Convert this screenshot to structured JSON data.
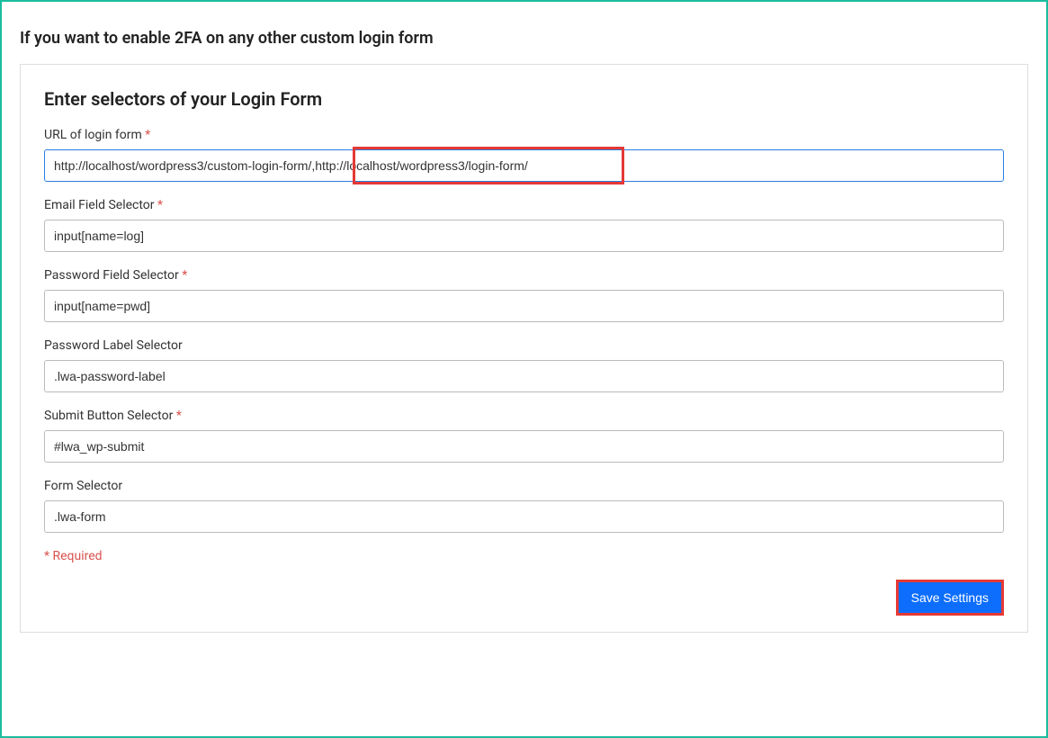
{
  "section_title": "If you want to enable 2FA on any other custom login form",
  "form_heading": "Enter selectors of your Login Form",
  "fields": {
    "url": {
      "label": "URL of login form",
      "required": true,
      "value": "http://localhost/wordpress3/custom-login-form/,http://localhost/wordpress3/login-form/"
    },
    "email_selector": {
      "label": "Email Field Selector",
      "required": true,
      "value": "input[name=log]"
    },
    "password_selector": {
      "label": "Password Field Selector",
      "required": true,
      "value": "input[name=pwd]"
    },
    "password_label_selector": {
      "label": "Password Label Selector",
      "required": false,
      "value": ".lwa-password-label"
    },
    "submit_selector": {
      "label": "Submit Button Selector",
      "required": true,
      "value": "#lwa_wp-submit"
    },
    "form_selector": {
      "label": "Form Selector",
      "required": false,
      "value": ".lwa-form"
    }
  },
  "required_note": "* Required",
  "save_button_label": "Save Settings",
  "required_star": " *"
}
